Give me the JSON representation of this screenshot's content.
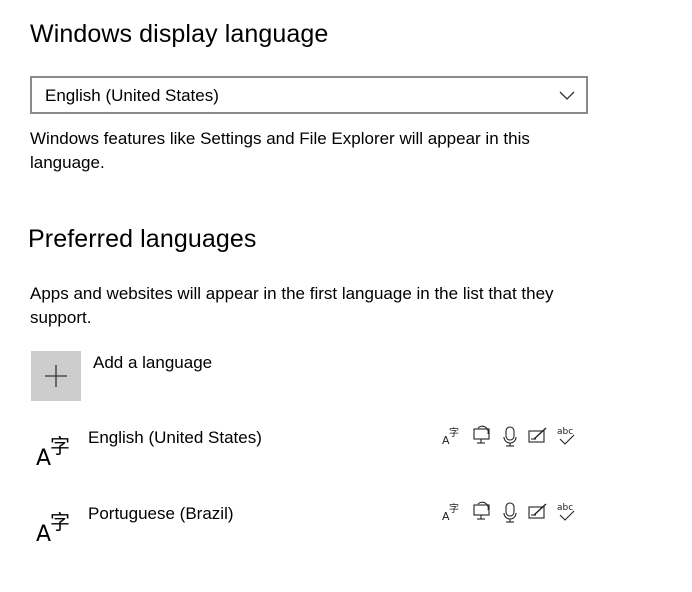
{
  "display_language": {
    "heading": "Windows display language",
    "selected": "English (United States)",
    "description": "Windows features like Settings and File Explorer will appear in this language."
  },
  "preferred": {
    "heading": "Preferred languages",
    "description": "Apps and websites will appear in the first language in the list that they support.",
    "add_label": "Add a language",
    "languages": [
      {
        "name": "English (United States)",
        "features": [
          "display-language-icon",
          "speech-display-icon",
          "microphone-icon",
          "handwriting-icon",
          "spellcheck-icon"
        ]
      },
      {
        "name": "Portuguese (Brazil)",
        "features": [
          "display-language-icon",
          "speech-display-icon",
          "microphone-icon",
          "handwriting-icon",
          "spellcheck-icon"
        ]
      }
    ]
  }
}
